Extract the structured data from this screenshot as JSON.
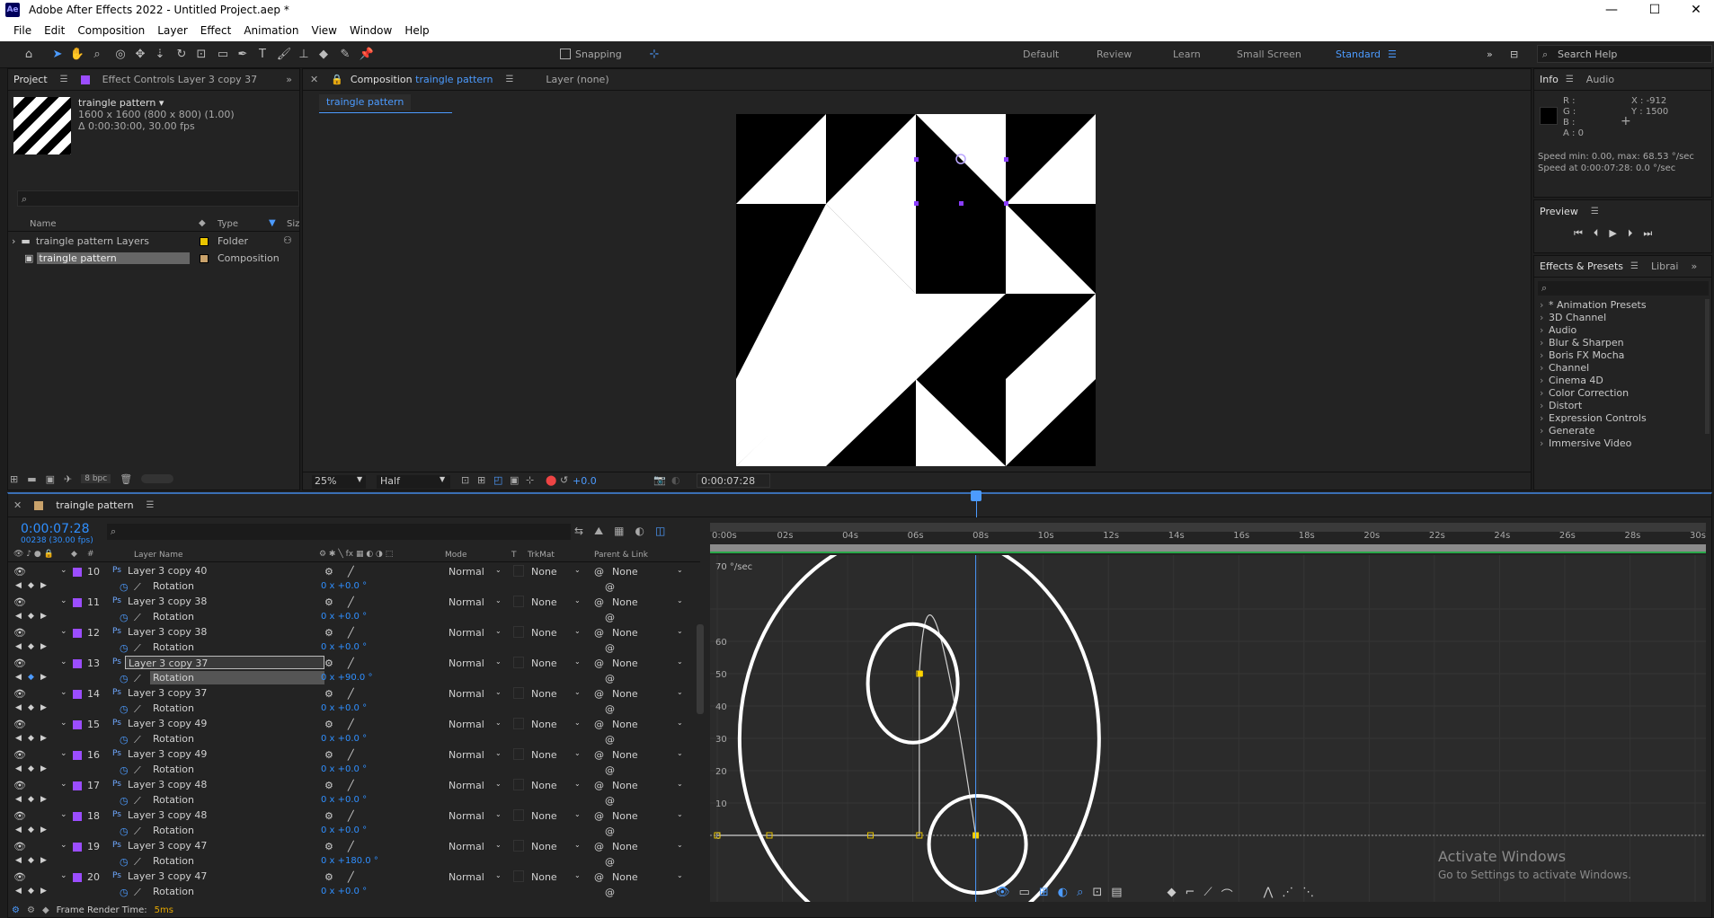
{
  "window": {
    "title": "Adobe After Effects 2022 - Untitled Project.aep *",
    "logo": "Ae",
    "minimize": "—",
    "maximize": "☐",
    "close": "✕"
  },
  "menu": [
    "File",
    "Edit",
    "Composition",
    "Layer",
    "Effect",
    "Animation",
    "View",
    "Window",
    "Help"
  ],
  "toolbar": {
    "snapping": "Snapping",
    "workspaces": [
      "Default",
      "Review",
      "Learn",
      "Small Screen",
      "Standard"
    ],
    "search_placeholder": "Search Help"
  },
  "project": {
    "tab": "Project",
    "effect_tab": "Effect Controls Layer 3 copy 37",
    "item_name": "traingle pattern ▾",
    "item_size": "1600 x 1600  (800 x 800) (1.00)",
    "item_duration": "Δ 0:00:30:00, 30.00 fps",
    "search_placeholder": "",
    "col_name": "Name",
    "col_type": "Type",
    "col_size": "Siz",
    "items": [
      {
        "name": "traingle pattern Layers",
        "type": "Folder",
        "color": "#e9c400"
      },
      {
        "name": "traingle pattern",
        "type": "Composition",
        "color": "#c9a26b"
      }
    ],
    "bpc": "8 bpc"
  },
  "comp_viewer": {
    "tab": "Composition",
    "comp_name": "traingle pattern",
    "layer_tab": "Layer  (none)",
    "sub_tab": "traingle pattern",
    "zoom": "25%",
    "resolution": "Half",
    "exposure": "+0.0",
    "timecode": "0:00:07:28"
  },
  "info": {
    "tab": "Info",
    "audio_tab": "Audio",
    "r": "R :",
    "g": "G :",
    "b": "B :",
    "a": "A :  0",
    "x": "X : -912",
    "y": "Y :  1500",
    "speed1": "Speed min: 0.00, max: 68.53 °/sec",
    "speed2": "Speed at 0:00:07:28: 0.0 °/sec"
  },
  "preview": {
    "tab": "Preview"
  },
  "effects": {
    "tab": "Effects & Presets",
    "lib_tab": "Librai",
    "search_placeholder": "",
    "items": [
      "* Animation Presets",
      "3D Channel",
      "Audio",
      "Blur & Sharpen",
      "Boris FX Mocha",
      "Channel",
      "Cinema 4D",
      "Color Correction",
      "Distort",
      "Expression Controls",
      "Generate",
      "Immersive Video"
    ]
  },
  "timeline": {
    "tab": "traingle pattern",
    "timecode": "0:00:07:28",
    "frame_info": "00238 (30.00 fps)",
    "col_layer": "Layer Name",
    "col_mode": "Mode",
    "col_t": "T",
    "col_trkmat": "TrkMat",
    "col_parent": "Parent & Link",
    "ruler": [
      "0:00s",
      "02s",
      "04s",
      "06s",
      "08s",
      "10s",
      "12s",
      "14s",
      "16s",
      "18s",
      "20s",
      "22s",
      "24s",
      "26s",
      "28s",
      "30s"
    ],
    "graph_unit": "70 °/sec",
    "graph_y": [
      "60",
      "50",
      "40",
      "30",
      "20",
      "10",
      "0"
    ],
    "render_time_label": "Frame Render Time:",
    "render_time": "5ms",
    "layers": [
      {
        "num": "10",
        "name": "Layer 3 copy 40",
        "mode": "Normal",
        "trk": "None",
        "parent": "None",
        "prop": "Rotation",
        "val": "0 x +0.0 °"
      },
      {
        "num": "11",
        "name": "Layer 3 copy 38",
        "mode": "Normal",
        "trk": "None",
        "parent": "None",
        "prop": "Rotation",
        "val": "0 x +0.0 °"
      },
      {
        "num": "12",
        "name": "Layer 3 copy 38",
        "mode": "Normal",
        "trk": "None",
        "parent": "None",
        "prop": "Rotation",
        "val": "0 x +0.0 °"
      },
      {
        "num": "13",
        "name": "Layer 3 copy 37",
        "mode": "Normal",
        "trk": "None",
        "parent": "None",
        "prop": "Rotation",
        "val": "0 x +90.0 °"
      },
      {
        "num": "14",
        "name": "Layer 3 copy 37",
        "mode": "Normal",
        "trk": "None",
        "parent": "None",
        "prop": "Rotation",
        "val": "0 x +0.0 °"
      },
      {
        "num": "15",
        "name": "Layer 3 copy 49",
        "mode": "Normal",
        "trk": "None",
        "parent": "None",
        "prop": "Rotation",
        "val": "0 x +0.0 °"
      },
      {
        "num": "16",
        "name": "Layer 3 copy 49",
        "mode": "Normal",
        "trk": "None",
        "parent": "None",
        "prop": "Rotation",
        "val": "0 x +0.0 °"
      },
      {
        "num": "17",
        "name": "Layer 3 copy 48",
        "mode": "Normal",
        "trk": "None",
        "parent": "None",
        "prop": "Rotation",
        "val": "0 x +0.0 °"
      },
      {
        "num": "18",
        "name": "Layer 3 copy 48",
        "mode": "Normal",
        "trk": "None",
        "parent": "None",
        "prop": "Rotation",
        "val": "0 x +0.0 °"
      },
      {
        "num": "19",
        "name": "Layer 3 copy 47",
        "mode": "Normal",
        "trk": "None",
        "parent": "None",
        "prop": "Rotation",
        "val": "0 x +180.0 °"
      },
      {
        "num": "20",
        "name": "Layer 3 copy 47",
        "mode": "Normal",
        "trk": "None",
        "parent": "None",
        "prop": "Rotation",
        "val": "0 x +0.0 °"
      }
    ]
  },
  "watermark": {
    "line1": "Activate Windows",
    "line2": "Go to Settings to activate Windows."
  }
}
